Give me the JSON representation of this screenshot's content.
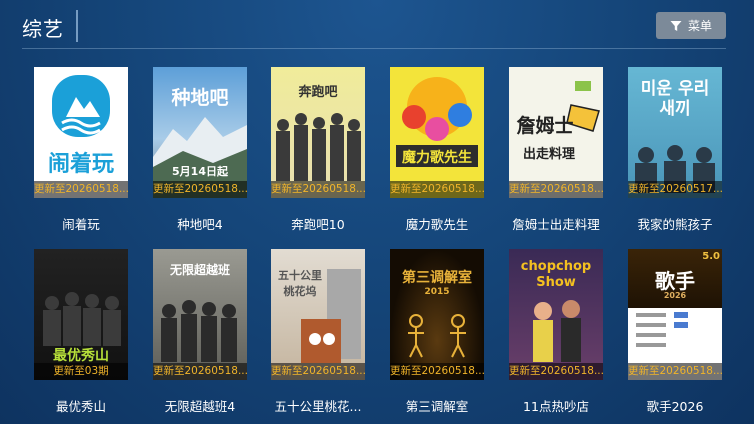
{
  "header": {
    "title": "综艺",
    "menu_label": "菜单"
  },
  "shows": [
    {
      "name": "闹着玩",
      "update": "更新至20260518...",
      "poster_text": "闹着玩",
      "bg": "#ffffff",
      "fg": "#1ba0d8"
    },
    {
      "name": "种地吧4",
      "update": "更新至20260518...",
      "poster_text": "种地吧",
      "poster_sub": "5月14日起",
      "bg": "#6aa5d8",
      "fg": "#ffffff"
    },
    {
      "name": "奔跑吧10",
      "update": "更新至20260518...",
      "poster_text": "奔跑吧",
      "bg": "#ece8b0",
      "fg": "#333333"
    },
    {
      "name": "魔力歌先生",
      "update": "更新至20260518...",
      "poster_text": "魔力歌先生",
      "bg": "#f3e43a",
      "fg": "#1c1c1c"
    },
    {
      "name": "詹姆士出走料理",
      "update": "更新至20260518...",
      "poster_text": "詹姆士",
      "poster_sub": "出走料理",
      "bg": "#f4f4ea",
      "fg": "#222222"
    },
    {
      "name": "我家的熊孩子",
      "update": "更新至20260517...",
      "poster_text": "미운 우리새끼",
      "bg": "#5aa9c8",
      "fg": "#ffffff"
    },
    {
      "name": "最优秀山",
      "update": "更新至03期",
      "poster_text": "最优秀山",
      "bg": "#1a1a1a",
      "fg": "#b7e03a"
    },
    {
      "name": "无限超越班4",
      "update": "更新至20260518...",
      "poster_text": "无限超越班",
      "bg": "#8b8b85",
      "fg": "#ffffff"
    },
    {
      "name": "五十公里桃花...",
      "update": "更新至20260518...",
      "poster_text": "五十公里桃花坞",
      "bg": "#d9d2c8",
      "fg": "#555555"
    },
    {
      "name": "第三调解室",
      "update": "更新至20260518...",
      "poster_text": "第三调解室",
      "poster_sub": "2015",
      "bg": "#1a1205",
      "fg": "#e8b23a"
    },
    {
      "name": "11点热吵店",
      "update": "更新至20260518...",
      "poster_text": "chopchop Show",
      "bg": "#3a2a55",
      "fg": "#f4c020"
    },
    {
      "name": "歌手2026",
      "update": "更新至20260518...",
      "poster_text": "歌手",
      "poster_sub": "2026",
      "badge": "5.0",
      "bg": "#2a1a08",
      "fg": "#ffffff"
    }
  ]
}
